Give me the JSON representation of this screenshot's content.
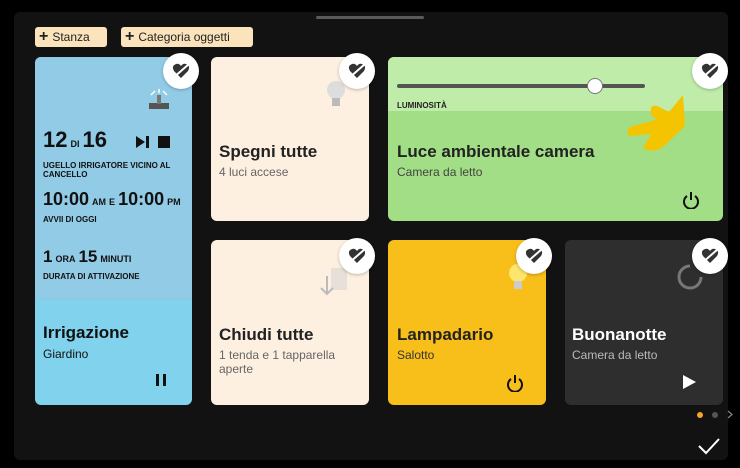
{
  "toolbar": {
    "add_room_label": "Stanza",
    "add_category_label": "Categoria oggetti"
  },
  "cards": {
    "irrigation": {
      "start_hour": "12",
      "start_of": "di",
      "start_min": "16",
      "nozzle_label": "Ugello irrigatore vicino al cancello",
      "time_from": "10:00",
      "time_from_ampm": "AM",
      "time_connector": "E",
      "time_to": "10:00",
      "time_to_ampm": "PM",
      "starts_label": "Avvii di oggi",
      "dur_hours": "1",
      "dur_hours_unit": "ora",
      "dur_minutes": "15",
      "dur_minutes_unit": "minuti",
      "duration_label": "Durata di attivazione",
      "title": "Irrigazione",
      "subtitle": "Giardino"
    },
    "lights_off": {
      "title": "Spegni tutte",
      "subtitle": "4 luci accese"
    },
    "ambient_light": {
      "brightness_label": "LUMINOSITÀ",
      "brightness_level": 0.8,
      "title": "Luce ambientale camera",
      "subtitle": "Camera da letto"
    },
    "close_all": {
      "title": "Chiudi tutte",
      "subtitle": "1 tenda e 1 tapparella aperte"
    },
    "chandelier": {
      "title": "Lampadario",
      "subtitle": "Salotto"
    },
    "goodnight": {
      "title": "Buonanotte",
      "subtitle": "Camera da letto"
    }
  },
  "pagination": {
    "current": 1,
    "total": 2
  },
  "colors": {
    "accent": "#f5a623",
    "irrigation": "#92cbe6",
    "light_card": "#a2de86",
    "chandelier": "#f8bf1a",
    "scene_card": "#2e2e2e"
  }
}
